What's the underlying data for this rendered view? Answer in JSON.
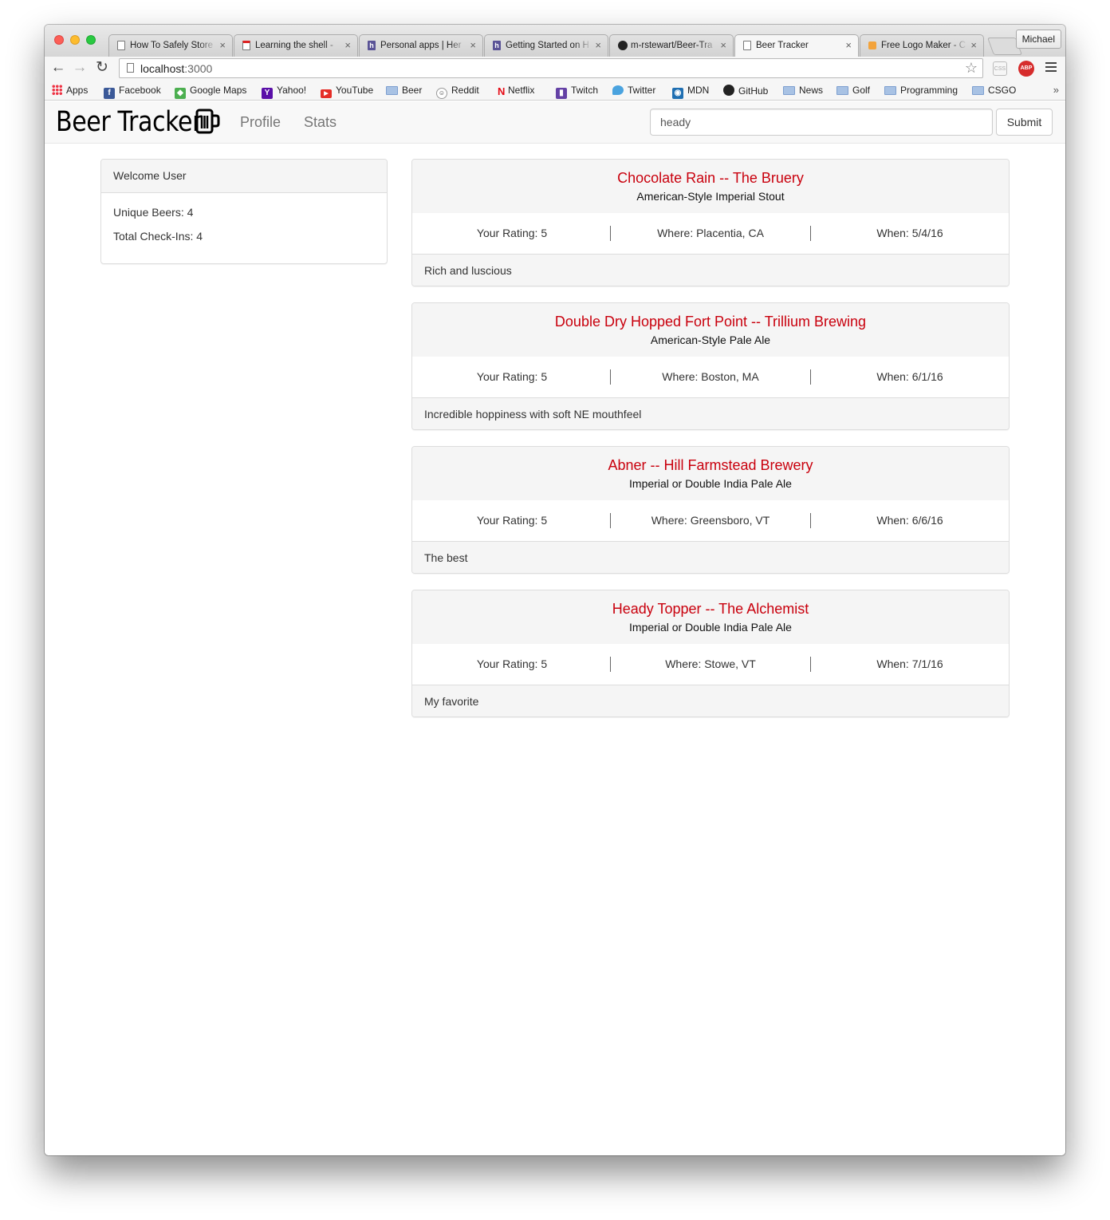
{
  "browser": {
    "tabs": [
      {
        "title": "How To Safely Store"
      },
      {
        "title": "Learning the shell -"
      },
      {
        "title": "Personal apps | Her"
      },
      {
        "title": "Getting Started on H"
      },
      {
        "title": "m-rstewart/Beer-Tra"
      },
      {
        "title": "Beer Tracker"
      },
      {
        "title": "Free Logo Maker - C"
      }
    ],
    "profile_name": "Michael",
    "url_host": "localhost",
    "url_port": ":3000",
    "extensions": {
      "css": "CSS",
      "abp": "ABP"
    },
    "bookmarks": [
      "Apps",
      "Facebook",
      "Google Maps",
      "Yahoo!",
      "YouTube",
      "Beer",
      "Reddit",
      "Netflix",
      "Twitch",
      "Twitter",
      "MDN",
      "GitHub",
      "News",
      "Golf",
      "Programming",
      "CSGO"
    ],
    "bookmarks_more": "»"
  },
  "app": {
    "brand": "Beer Tracker",
    "nav": {
      "profile": "Profile",
      "stats": "Stats"
    },
    "search": {
      "value": "heady"
    },
    "submit_label": "Submit",
    "accent_color": "#c9000d"
  },
  "sidebar": {
    "heading": "Welcome User",
    "unique_beers": "Unique Beers: 4",
    "total_checkins": "Total Check-Ins: 4"
  },
  "checkins": [
    {
      "title": "Chocolate Rain -- The Bruery",
      "style": "American-Style Imperial Stout",
      "rating": "Your Rating: 5",
      "where": "Where: Placentia, CA",
      "when": "When: 5/4/16",
      "note": "Rich and luscious"
    },
    {
      "title": "Double Dry Hopped Fort Point -- Trillium Brewing",
      "style": "American-Style Pale Ale",
      "rating": "Your Rating: 5",
      "where": "Where: Boston, MA",
      "when": "When: 6/1/16",
      "note": "Incredible hoppiness with soft NE mouthfeel"
    },
    {
      "title": "Abner -- Hill Farmstead Brewery",
      "style": "Imperial or Double India Pale Ale",
      "rating": "Your Rating: 5",
      "where": "Where: Greensboro, VT",
      "when": "When: 6/6/16",
      "note": "The best"
    },
    {
      "title": "Heady Topper -- The Alchemist",
      "style": "Imperial or Double India Pale Ale",
      "rating": "Your Rating: 5",
      "where": "Where: Stowe, VT",
      "when": "When: 7/1/16",
      "note": "My favorite"
    }
  ]
}
